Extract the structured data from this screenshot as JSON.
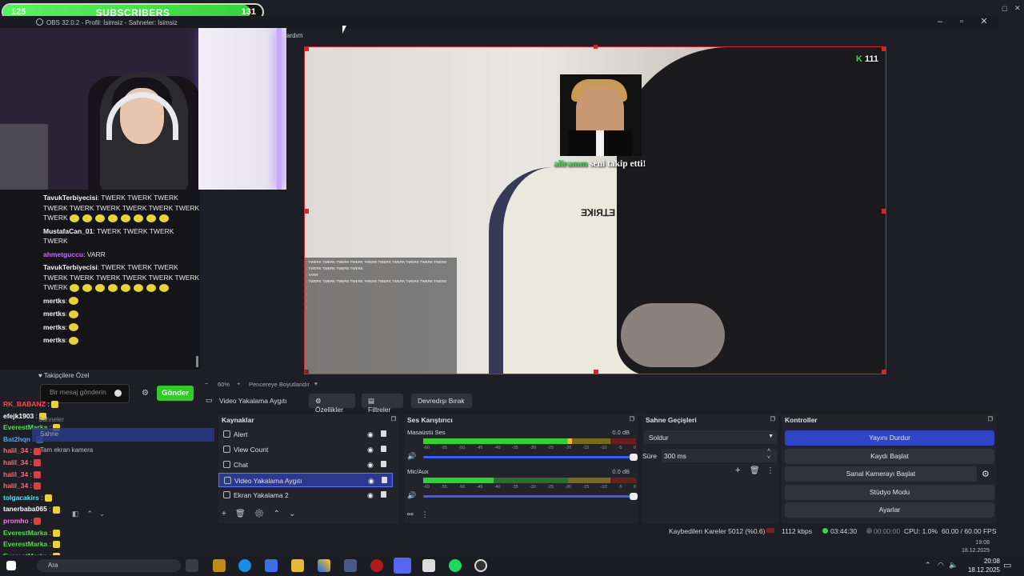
{
  "subscriber_bar": {
    "current": "125",
    "label": "SUBSCRIBERS",
    "goal": "131",
    "progress": 0.954
  },
  "obs": {
    "title": "OBS 32.0.2 - Profil: İsimsiz - Sahneler: İsimsiz",
    "menu_fragment": "ardım"
  },
  "overlay_chat": {
    "messages": [
      {
        "user": "TavukTerbiyecisi",
        "user_color": "#f5f5f5",
        "text": ": TWERK  TWERK  TWERK  TWERK  TWERK  TWERK  TWERK  TWERK  TWERK  TWERK",
        "emotes": 8
      },
      {
        "user": "MustafaCan_01",
        "user_color": "#f5f5f5",
        "text": ": TWERK  TWERK  TWERK  TWERK",
        "emotes": 0
      },
      {
        "user": "ahmetguccu",
        "user_color": "#c86cff",
        "text": ": VARR",
        "emotes": 0
      },
      {
        "user": "TavukTerbiyecisi",
        "user_color": "#f5f5f5",
        "text": ": TWERK  TWERK  TWERK  TWERK  TWERK  TWERK  TWERK  TWERK  TWERK  TWERK",
        "emotes": 8
      },
      {
        "user": "mertks",
        "user_color": "#f5f5f5",
        "text": ":",
        "emotes": 1
      },
      {
        "user": "mertks",
        "user_color": "#f5f5f5",
        "text": ":",
        "emotes": 1
      },
      {
        "user": "mertks",
        "user_color": "#f5f5f5",
        "text": ":",
        "emotes": 1
      },
      {
        "user": "mertks",
        "user_color": "#f5f5f5",
        "text": ":",
        "emotes": 1
      }
    ],
    "followers_only": "Takipçilere Özel",
    "input_placeholder": "Bir mesaj gönderin",
    "send_label": "Gönder"
  },
  "stream_chat": {
    "rows": [
      {
        "user": "RK_BABANZ",
        "color": "#ff4a4a"
      },
      {
        "user": "efejk1903",
        "color": "#ffffff"
      },
      {
        "user": "EverestMarka",
        "color": "#50e14a"
      },
      {
        "user": "Bat2hqn",
        "color": "#4aa6ff"
      },
      {
        "user": "halil_34",
        "color": "#ff6a6a"
      },
      {
        "user": "halil_34",
        "color": "#ff6a6a"
      },
      {
        "user": "halil_34",
        "color": "#ff6a6a"
      },
      {
        "user": "halil_34",
        "color": "#ff6a6a"
      },
      {
        "user": "tolgacakirs",
        "color": "#52e4ff"
      },
      {
        "user": "tanerbaba065",
        "color": "#ffffff"
      },
      {
        "user": "promho",
        "color": "#ff77e6"
      },
      {
        "user": "EverestMarka",
        "color": "#50e14a"
      },
      {
        "user": "EverestMarka",
        "color": "#50e14a"
      },
      {
        "user": "EverestMarka",
        "color": "#50e14a"
      }
    ],
    "scenes_fragment": "Sahneler",
    "scene_item": "Sahne",
    "screen_capture_fragment": "Tam ekran kamera"
  },
  "preview": {
    "follower_name": "aliramm",
    "follow_message": "seni takip etti!",
    "view_count": "111",
    "zoom": "60%",
    "resize_label": "Pencereye Boyutlandır"
  },
  "source_toolbar": {
    "current_source": "Video Yakalama Aygıtı",
    "properties": "Özellikler",
    "filters": "Filtreler",
    "deactivate": "Devredışı Bırak"
  },
  "sources": {
    "title": "Kaynaklar",
    "items": [
      {
        "label": "Alert",
        "icon": "globe-icon",
        "selected": false
      },
      {
        "label": "View Count",
        "icon": "globe-icon",
        "selected": false
      },
      {
        "label": "Chat",
        "icon": "globe-icon",
        "selected": false
      },
      {
        "label": "Video Yakalama Aygıtı",
        "icon": "camera-icon",
        "selected": true
      },
      {
        "label": "Ekran Yakalama 2",
        "icon": "monitor-icon",
        "selected": false
      }
    ]
  },
  "mixer": {
    "title": "Ses Karıştırıcı",
    "tracks": [
      {
        "name": "Masaüstü Ses",
        "db": "0.0 dB",
        "level": 0.7
      },
      {
        "name": "Mic/Aux",
        "db": "0.0 dB",
        "level": 0.33
      }
    ],
    "scale": [
      "-60",
      "-55",
      "-50",
      "-45",
      "-40",
      "-35",
      "-30",
      "-25",
      "-20",
      "-15",
      "-10",
      "-5",
      "0"
    ]
  },
  "transitions": {
    "title": "Sahne Geçişleri",
    "selected": "Soldur",
    "duration_label": "Süre",
    "duration": "300 ms"
  },
  "controls": {
    "title": "Kontroller",
    "buttons": [
      "Yayını Durdur",
      "Kaydı Başlat",
      "Sanal Kamerayı Başlat",
      "Stüdyo Modu",
      "Ayarlar"
    ]
  },
  "status": {
    "dropped": "Kaybedilen Kareler 5012 (%0.6)",
    "bitrate": "1112 kbps",
    "stream_time": "03:44:30",
    "rec_time": "00:00:00",
    "cpu": "CPU: 1.0%",
    "fps": "60.00 / 60.00 FPS"
  },
  "taskbar": {
    "search": "Ara",
    "time": "20:08",
    "date": "18.12.2025",
    "time_small": "19:08",
    "date_small": "18.12.2025"
  }
}
